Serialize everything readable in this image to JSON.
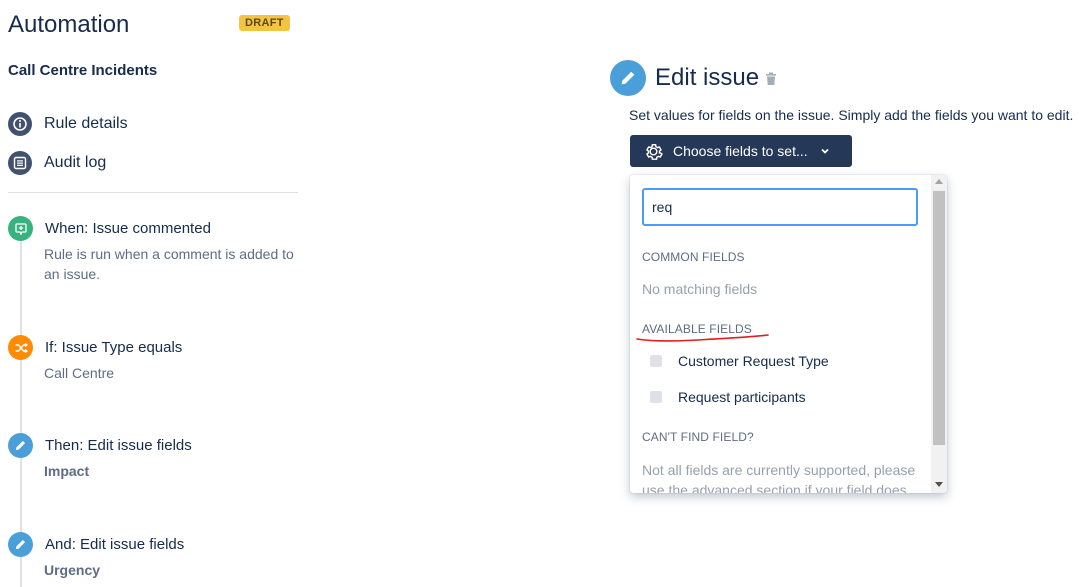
{
  "app": {
    "title": "Automation",
    "badge": "DRAFT",
    "rule_name": "Call Centre Incidents"
  },
  "nav": {
    "rule_details": "Rule details",
    "audit_log": "Audit log"
  },
  "steps": [
    {
      "title": "When: Issue commented",
      "sub": "Rule is run when a comment is added to an issue.",
      "icon": "trigger-icon",
      "color": "#36b37e"
    },
    {
      "title": "If: Issue Type equals",
      "sub": "Call Centre",
      "icon": "shuffle-icon",
      "color": "#ff8b00"
    },
    {
      "title": "Then: Edit issue fields",
      "sub": "Impact",
      "icon": "pencil-icon",
      "color": "#4a9fd8"
    },
    {
      "title": "And: Edit issue fields",
      "sub": "Urgency",
      "icon": "pencil-icon",
      "color": "#4a9fd8"
    }
  ],
  "edit": {
    "title": "Edit issue",
    "description": "Set values for fields on the issue. Simply add the fields you want to edit.",
    "choose_button": "Choose fields to set...",
    "search_value": "req",
    "common_fields_header": "COMMON FIELDS",
    "no_matching": "No matching fields",
    "available_fields_header": "AVAILABLE FIELDS",
    "options": [
      "Customer Request Type",
      "Request participants"
    ],
    "cant_find_header": "CAN'T FIND FIELD?",
    "hint": "Not all fields are currently supported, please use the advanced section if your field does"
  },
  "colors": {
    "button_bg": "#253858",
    "accent_blue": "#4a9fd8",
    "annotation_red": "#e11d1d",
    "badge_yellow": "#f3c443"
  }
}
